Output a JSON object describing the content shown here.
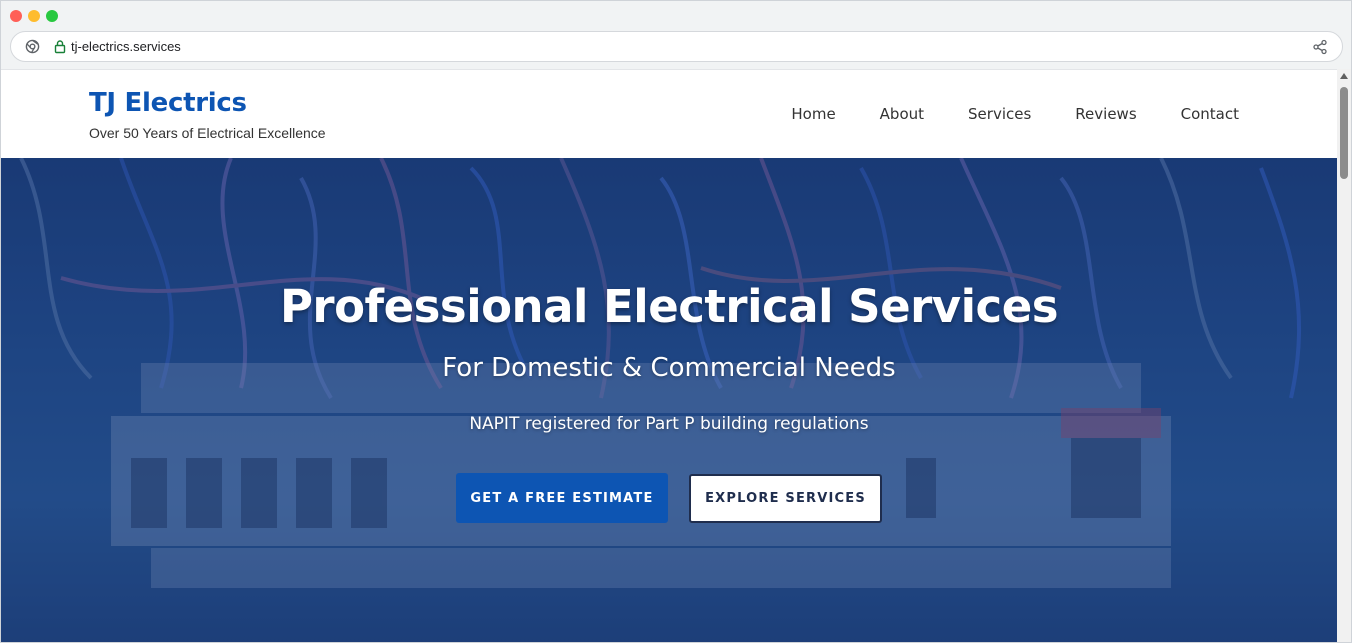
{
  "browser": {
    "url": "tj-electrics.services"
  },
  "header": {
    "brand": "TJ Electrics",
    "tagline": "Over 50 Years of Electrical Excellence",
    "nav": [
      "Home",
      "About",
      "Services",
      "Reviews",
      "Contact"
    ]
  },
  "hero": {
    "title": "Professional Electrical Services",
    "subtitle": "For Domestic & Commercial Needs",
    "note": "NAPIT registered for Part P building regulations",
    "primary_button": "GET A FREE ESTIMATE",
    "secondary_button": "EXPLORE SERVICES"
  },
  "colors": {
    "brand_blue": "#0d55b3",
    "hero_overlay": "#1d3f7a",
    "text_dark": "#333333"
  },
  "icons": [
    "browser-site-icon",
    "lock-icon",
    "share-icon"
  ]
}
